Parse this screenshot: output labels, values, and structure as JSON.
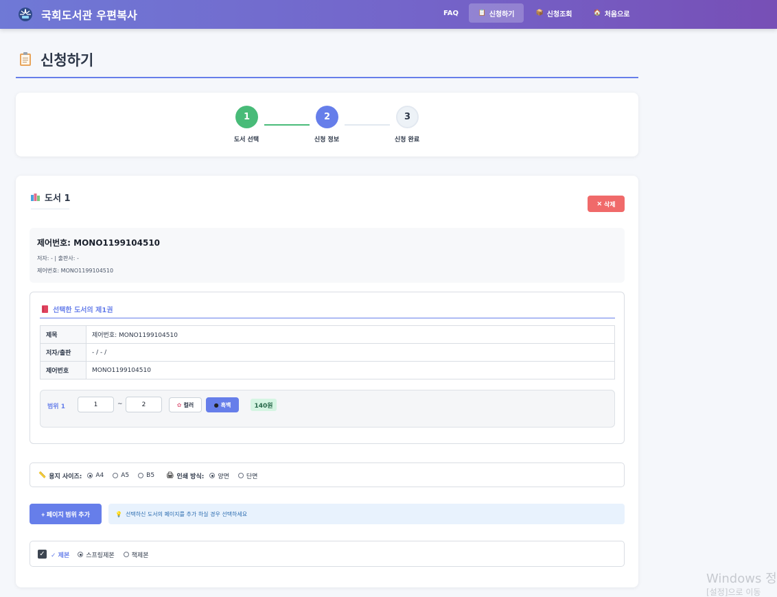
{
  "nav": {
    "brand_title": "국회도서관 우편복사",
    "items": [
      {
        "label": "FAQ",
        "icon": ""
      },
      {
        "label": "신청하기",
        "icon": "📋"
      },
      {
        "label": "신청조회",
        "icon": "📦"
      },
      {
        "label": "처음으로",
        "icon": "🏠"
      }
    ],
    "active_item": "신청하기"
  },
  "page": {
    "title": "신청하기"
  },
  "steps": [
    {
      "number": "1",
      "label": "도서 선택",
      "state": "done"
    },
    {
      "number": "2",
      "label": "신청 정보",
      "state": "active"
    },
    {
      "number": "3",
      "label": "신청 완료",
      "state": "pending"
    }
  ],
  "book": {
    "section_title": "도서 1",
    "delete_label": "삭제",
    "info_title": "제어번호: MONO1199104510",
    "info_author_publisher": "저자: - | 출판사: -",
    "info_control_number": "제어번호: MONO1199104510",
    "volume": {
      "title": "선택한 도서의 제1권",
      "rows": [
        {
          "header": "제목",
          "value": "제어번호: MONO1199104510"
        },
        {
          "header": "저자/출판",
          "value": "- / - /"
        },
        {
          "header": "제어번호",
          "value": "MONO1199104510"
        }
      ],
      "range": {
        "label": "범위 1",
        "from": "1",
        "separator": "~",
        "to": "2",
        "color_label": "컬러",
        "mono_label": "흑백",
        "selected_mode": "흑백",
        "price": "140원"
      }
    }
  },
  "options": {
    "paper_label": "용지 사이즈:",
    "paper_options": [
      "A4",
      "A5",
      "B5"
    ],
    "paper_selected": "A4",
    "print_label": "인쇄 방식:",
    "print_options": [
      "양면",
      "단면"
    ],
    "print_selected": "양면"
  },
  "add_range": {
    "button_label": "+ 페이지 범위 추가",
    "hint": "선택하신 도서의 페이지를 추가 하실 경우 선택하세요"
  },
  "binding": {
    "checked": true,
    "label": "✓ 제본",
    "options": [
      "스프링제본",
      "책제본"
    ],
    "selected": "스프링제본"
  },
  "watermark": {
    "line1": "Windows 정",
    "line2": "[설정]으로 이동"
  },
  "colors": {
    "accent": "#667eea",
    "step_done": "#48bb78",
    "delete": "#f06a6a",
    "price_bg": "#d5f5e3"
  }
}
